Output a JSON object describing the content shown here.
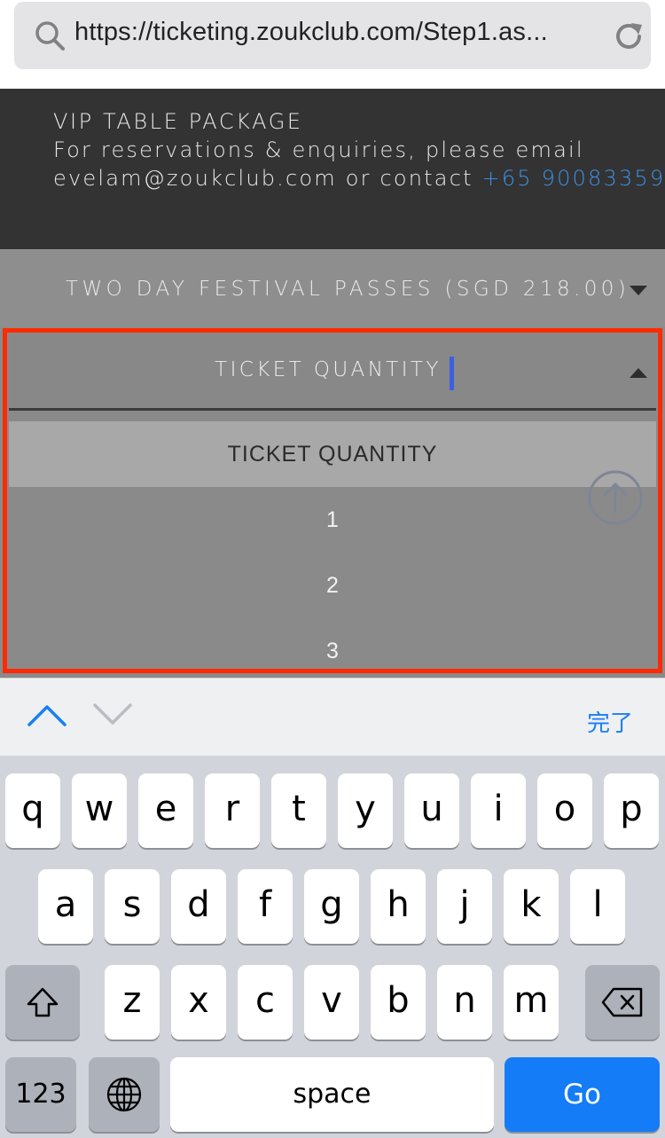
{
  "browser": {
    "url": "https://ticketing.zoukclub.com/Step1.as..."
  },
  "vip": {
    "line1": "VIP TABLE PACKAGE",
    "line2": "For reservations & enquiries, please email",
    "line3_prefix": "evelam@zoukclub.com or contact ",
    "phone": "+65 90083359"
  },
  "passes": {
    "label": "TWO DAY FESTIVAL PASSES (SGD 218.00)"
  },
  "quantity": {
    "header": "TICKET QUANTITY",
    "options": [
      "TICKET QUANTITY",
      "1",
      "2",
      "3"
    ],
    "selected_index": 0
  },
  "accessory": {
    "done_label": "完了"
  },
  "keyboard": {
    "row1": [
      "q",
      "w",
      "e",
      "r",
      "t",
      "y",
      "u",
      "i",
      "o",
      "p"
    ],
    "row2": [
      "a",
      "s",
      "d",
      "f",
      "g",
      "h",
      "j",
      "k",
      "l"
    ],
    "row3": [
      "z",
      "x",
      "c",
      "v",
      "b",
      "n",
      "m"
    ],
    "num_label": "123",
    "space_label": "space",
    "go_label": "Go"
  },
  "colors": {
    "highlight": "#ff2a00",
    "link": "#3d8fe0",
    "go_key": "#147cf6",
    "done": "#1a7ef5"
  }
}
